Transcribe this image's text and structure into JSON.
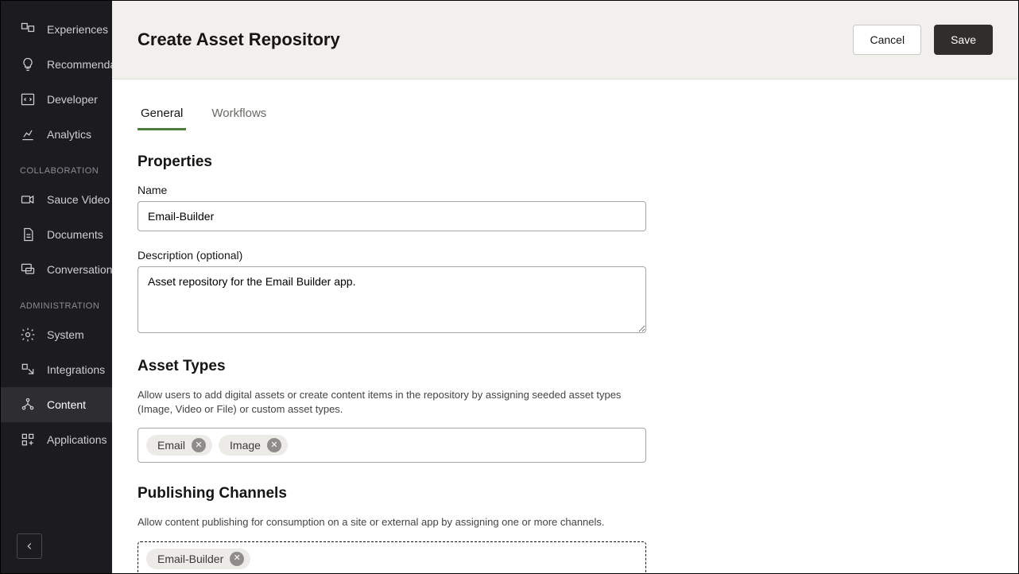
{
  "sidebar": {
    "items_top": [
      {
        "label": "Experiences",
        "icon": "experiences"
      },
      {
        "label": "Recommendations",
        "icon": "recommend"
      },
      {
        "label": "Developer",
        "icon": "developer"
      },
      {
        "label": "Analytics",
        "icon": "analytics"
      }
    ],
    "section_collab_label": "COLLABORATION",
    "items_collab": [
      {
        "label": "Sauce Video",
        "icon": "video"
      },
      {
        "label": "Documents",
        "icon": "documents"
      },
      {
        "label": "Conversations",
        "icon": "conversations"
      }
    ],
    "section_admin_label": "ADMINISTRATION",
    "items_admin": [
      {
        "label": "System",
        "icon": "system"
      },
      {
        "label": "Integrations",
        "icon": "integrations"
      },
      {
        "label": "Content",
        "icon": "content",
        "active": true
      },
      {
        "label": "Applications",
        "icon": "applications"
      }
    ]
  },
  "header": {
    "title": "Create Asset Repository",
    "cancel_label": "Cancel",
    "save_label": "Save"
  },
  "tabs": {
    "general": "General",
    "workflows": "Workflows"
  },
  "properties": {
    "section_title": "Properties",
    "name_label": "Name",
    "name_value": "Email-Builder",
    "description_label": "Description (optional)",
    "description_value": "Asset repository for the Email Builder app."
  },
  "asset_types": {
    "section_title": "Asset Types",
    "help_text": "Allow users to add digital assets or create content items in the repository by assigning seeded asset types (Image, Video or File) or custom asset types.",
    "chips": [
      "Email",
      "Image"
    ]
  },
  "publishing_channels": {
    "section_title": "Publishing Channels",
    "help_text": "Allow content publishing for consumption on a site or external app by assigning one or more channels.",
    "chips": [
      "Email-Builder"
    ]
  }
}
